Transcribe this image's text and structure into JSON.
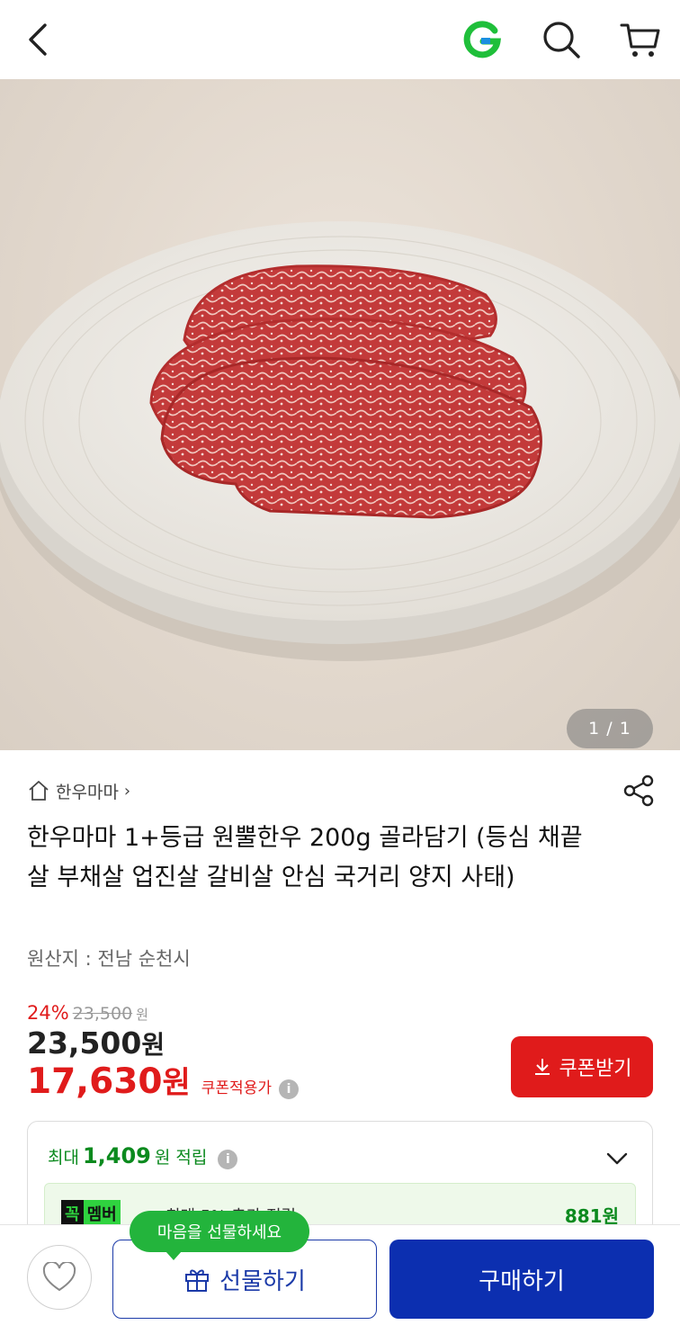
{
  "header": {
    "back_icon": "chevron-left-icon",
    "logo_letter": "G",
    "logo_color": "#1fbf3a",
    "search_icon": "search-icon",
    "cart_icon": "cart-icon"
  },
  "gallery": {
    "pager": "1 / 1"
  },
  "product": {
    "seller": "한우마마",
    "title": "한우마마 1+등급 원뿔한우 200g 골라담기 (등심 채끝살 부채살 업진살 갈비살 안심 국거리 양지 사태)",
    "origin": "원산지 : 전남 순천시",
    "discount_rate": "24%",
    "original_price": "23,500",
    "original_unit": "원",
    "price": "23,500",
    "price_unit": "원",
    "coupon_price": "17,630",
    "coupon_unit": "원",
    "coupon_label": "쿠폰적용가",
    "coupon_button": "쿠폰받기"
  },
  "points": {
    "prefix": "최대",
    "amount": "1,409",
    "suffix": "원 적립",
    "member_badge_k": "꼭",
    "member_badge_m": "멤버",
    "member_desc": "최대 5% 추가 적립",
    "member_amount": "881원"
  },
  "bottom": {
    "bubble": "마음을 선물하세요",
    "gift_label": "선물하기",
    "buy_label": "구매하기"
  },
  "colors": {
    "accent_red": "#e01b1b",
    "primary_blue": "#0c2fb0",
    "green": "#0b8a1e"
  }
}
